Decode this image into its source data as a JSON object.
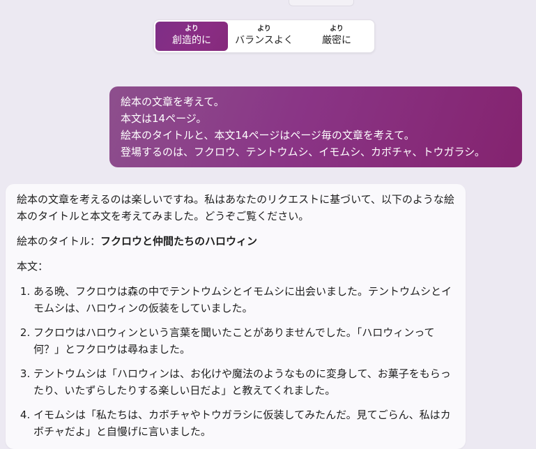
{
  "tone_selector": {
    "options": [
      {
        "prefix": "より",
        "label": "創造的に",
        "active": true
      },
      {
        "prefix": "より",
        "label": "バランスよく",
        "active": false
      },
      {
        "prefix": "より",
        "label": "厳密に",
        "active": false
      }
    ]
  },
  "user_message": {
    "lines": [
      "絵本の文章を考えて。",
      "本文は14ページ。",
      "絵本のタイトルと、本文14ページはページ毎の文章を考えて。",
      "登場するのは、フクロウ、テントウムシ、イモムシ、カボチャ、トウガラシ。"
    ]
  },
  "bot_message": {
    "intro": "絵本の文章を考えるのは楽しいですね。私はあなたのリクエストに基づいて、以下のような絵本のタイトルと本文を考えてみました。どうぞご覧ください。",
    "title_label": "絵本のタイトル：",
    "title_value": "フクロウと仲間たちのハロウィン",
    "body_label": "本文：",
    "pages": [
      "ある晩、フクロウは森の中でテントウムシとイモムシに出会いました。テントウムシとイモムシは、ハロウィンの仮装をしていました。",
      "フクロウはハロウィンという言葉を聞いたことがありませんでした。「ハロウィンって何？」とフクロウは尋ねました。",
      "テントウムシは「ハロウィンは、お化けや魔法のようなものに変身して、お菓子をもらったり、いたずらしたりする楽しい日だよ」と教えてくれました。",
      "イモムシは「私たちは、カボチャやトウガラシに仮装してみたんだ。見てごらん、私はカボチャだよ」と自慢げに言いました。"
    ]
  }
}
